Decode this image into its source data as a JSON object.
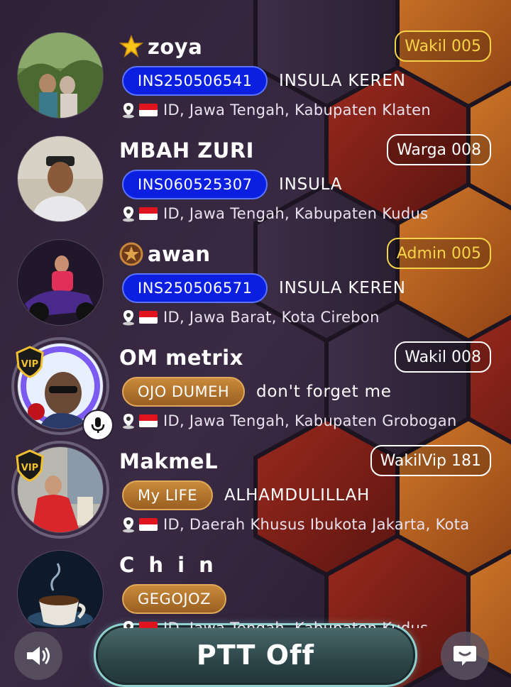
{
  "users": [
    {
      "name": "zoya",
      "crown": "star-crown-icon",
      "rank": "Wakil 005",
      "rank_color": "#f6d44a",
      "tag": "INS250506541",
      "tag_style": "blue",
      "tag_text": "INSULA KEREN",
      "location": "ID, Jawa Tengah, Kabupaten Klaten",
      "vip": false,
      "mic": false
    },
    {
      "name": "MBAH ZURI",
      "crown": "",
      "rank": "Warga 008",
      "rank_color": "#ffffff",
      "tag": "INS060525307",
      "tag_style": "blue",
      "tag_text": "INSULA",
      "location": "ID, Jawa Tengah, Kabupaten Kudus",
      "vip": false,
      "mic": false
    },
    {
      "name": "awan",
      "crown": "star-medal-icon",
      "rank": "Admin 005",
      "rank_color": "#f6d44a",
      "tag": "INS250506571",
      "tag_style": "blue",
      "tag_text": "INSULA KEREN",
      "location": "ID, Jawa Barat, Kota Cirebon",
      "vip": false,
      "mic": false
    },
    {
      "name": "OM metrix",
      "crown": "",
      "rank": "Wakil 008",
      "rank_color": "#ffffff",
      "tag": "OJO DUMEH",
      "tag_style": "brown",
      "tag_text": "don't forget me",
      "location": "ID, Jawa Tengah, Kabupaten Grobogan",
      "vip": true,
      "mic": true
    },
    {
      "name": "MakmeL",
      "crown": "",
      "rank": "WakilVip 181",
      "rank_color": "#ffffff",
      "tag": "My LIFE",
      "tag_style": "brown",
      "tag_text": "ALHAMDULILLAH",
      "location": "ID, Daerah Khusus Ibukota Jakarta, Kota",
      "vip": true,
      "mic": false
    },
    {
      "name": "C h i n",
      "crown": "",
      "rank": "",
      "rank_color": "#ffffff",
      "tag": "GEGOJOZ",
      "tag_style": "brown",
      "tag_text": "",
      "location": "ID, Jawa Tengah, Kabupaten Kudus",
      "vip": false,
      "mic": false
    }
  ],
  "vip_badge_text": "VIP",
  "controls": {
    "ptt_label": "PTT Off",
    "speaker_icon": "speaker-icon",
    "chat_icon": "chat-bubble-icon"
  },
  "colors": {
    "gold": "#f6d44a",
    "tag_blue": "#0a1fe0",
    "tag_brown": "#b0742e",
    "ptt_border": "#8fd0cf"
  }
}
